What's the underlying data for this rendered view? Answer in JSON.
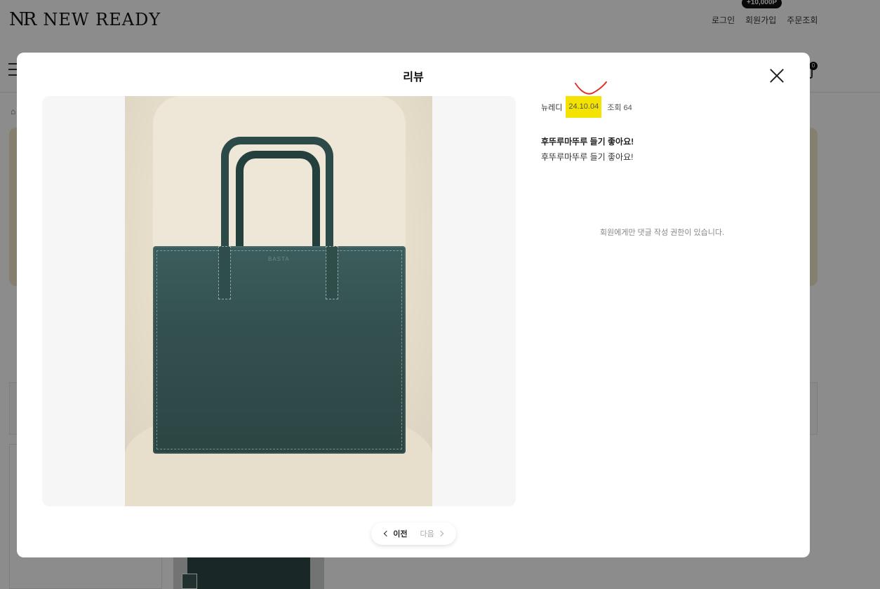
{
  "site": {
    "logo_mark": "NR",
    "logo_text": "NEW READY",
    "top_links": [
      "로그인",
      "회원가입",
      "주문조회"
    ],
    "point_badge": "+10,000P",
    "cart_count": "0"
  },
  "modal": {
    "title": "리뷰",
    "review": {
      "author": "뉴레디",
      "date": "24.10.04",
      "views": "조회 64",
      "title": "후뚜루마뚜루 들기 좋아요!",
      "body": "후뚜루마뚜루 들기 좋아요!"
    },
    "photo_brand_stamp": "BASTA",
    "comment_notice": "회원에게만 댓글 작성 권한이 있습니다.",
    "pager": {
      "prev_label": "이전",
      "next_label": "다음"
    }
  },
  "colors": {
    "date_highlight": "#f4e300",
    "annotation": "#e0302a",
    "bag": "#33504f",
    "overlay": "rgba(0,0,0,0.45)"
  },
  "icons": [
    "menu-icon",
    "cart-icon",
    "home-icon",
    "close-icon",
    "chevron-left-icon",
    "chevron-right-icon"
  ]
}
